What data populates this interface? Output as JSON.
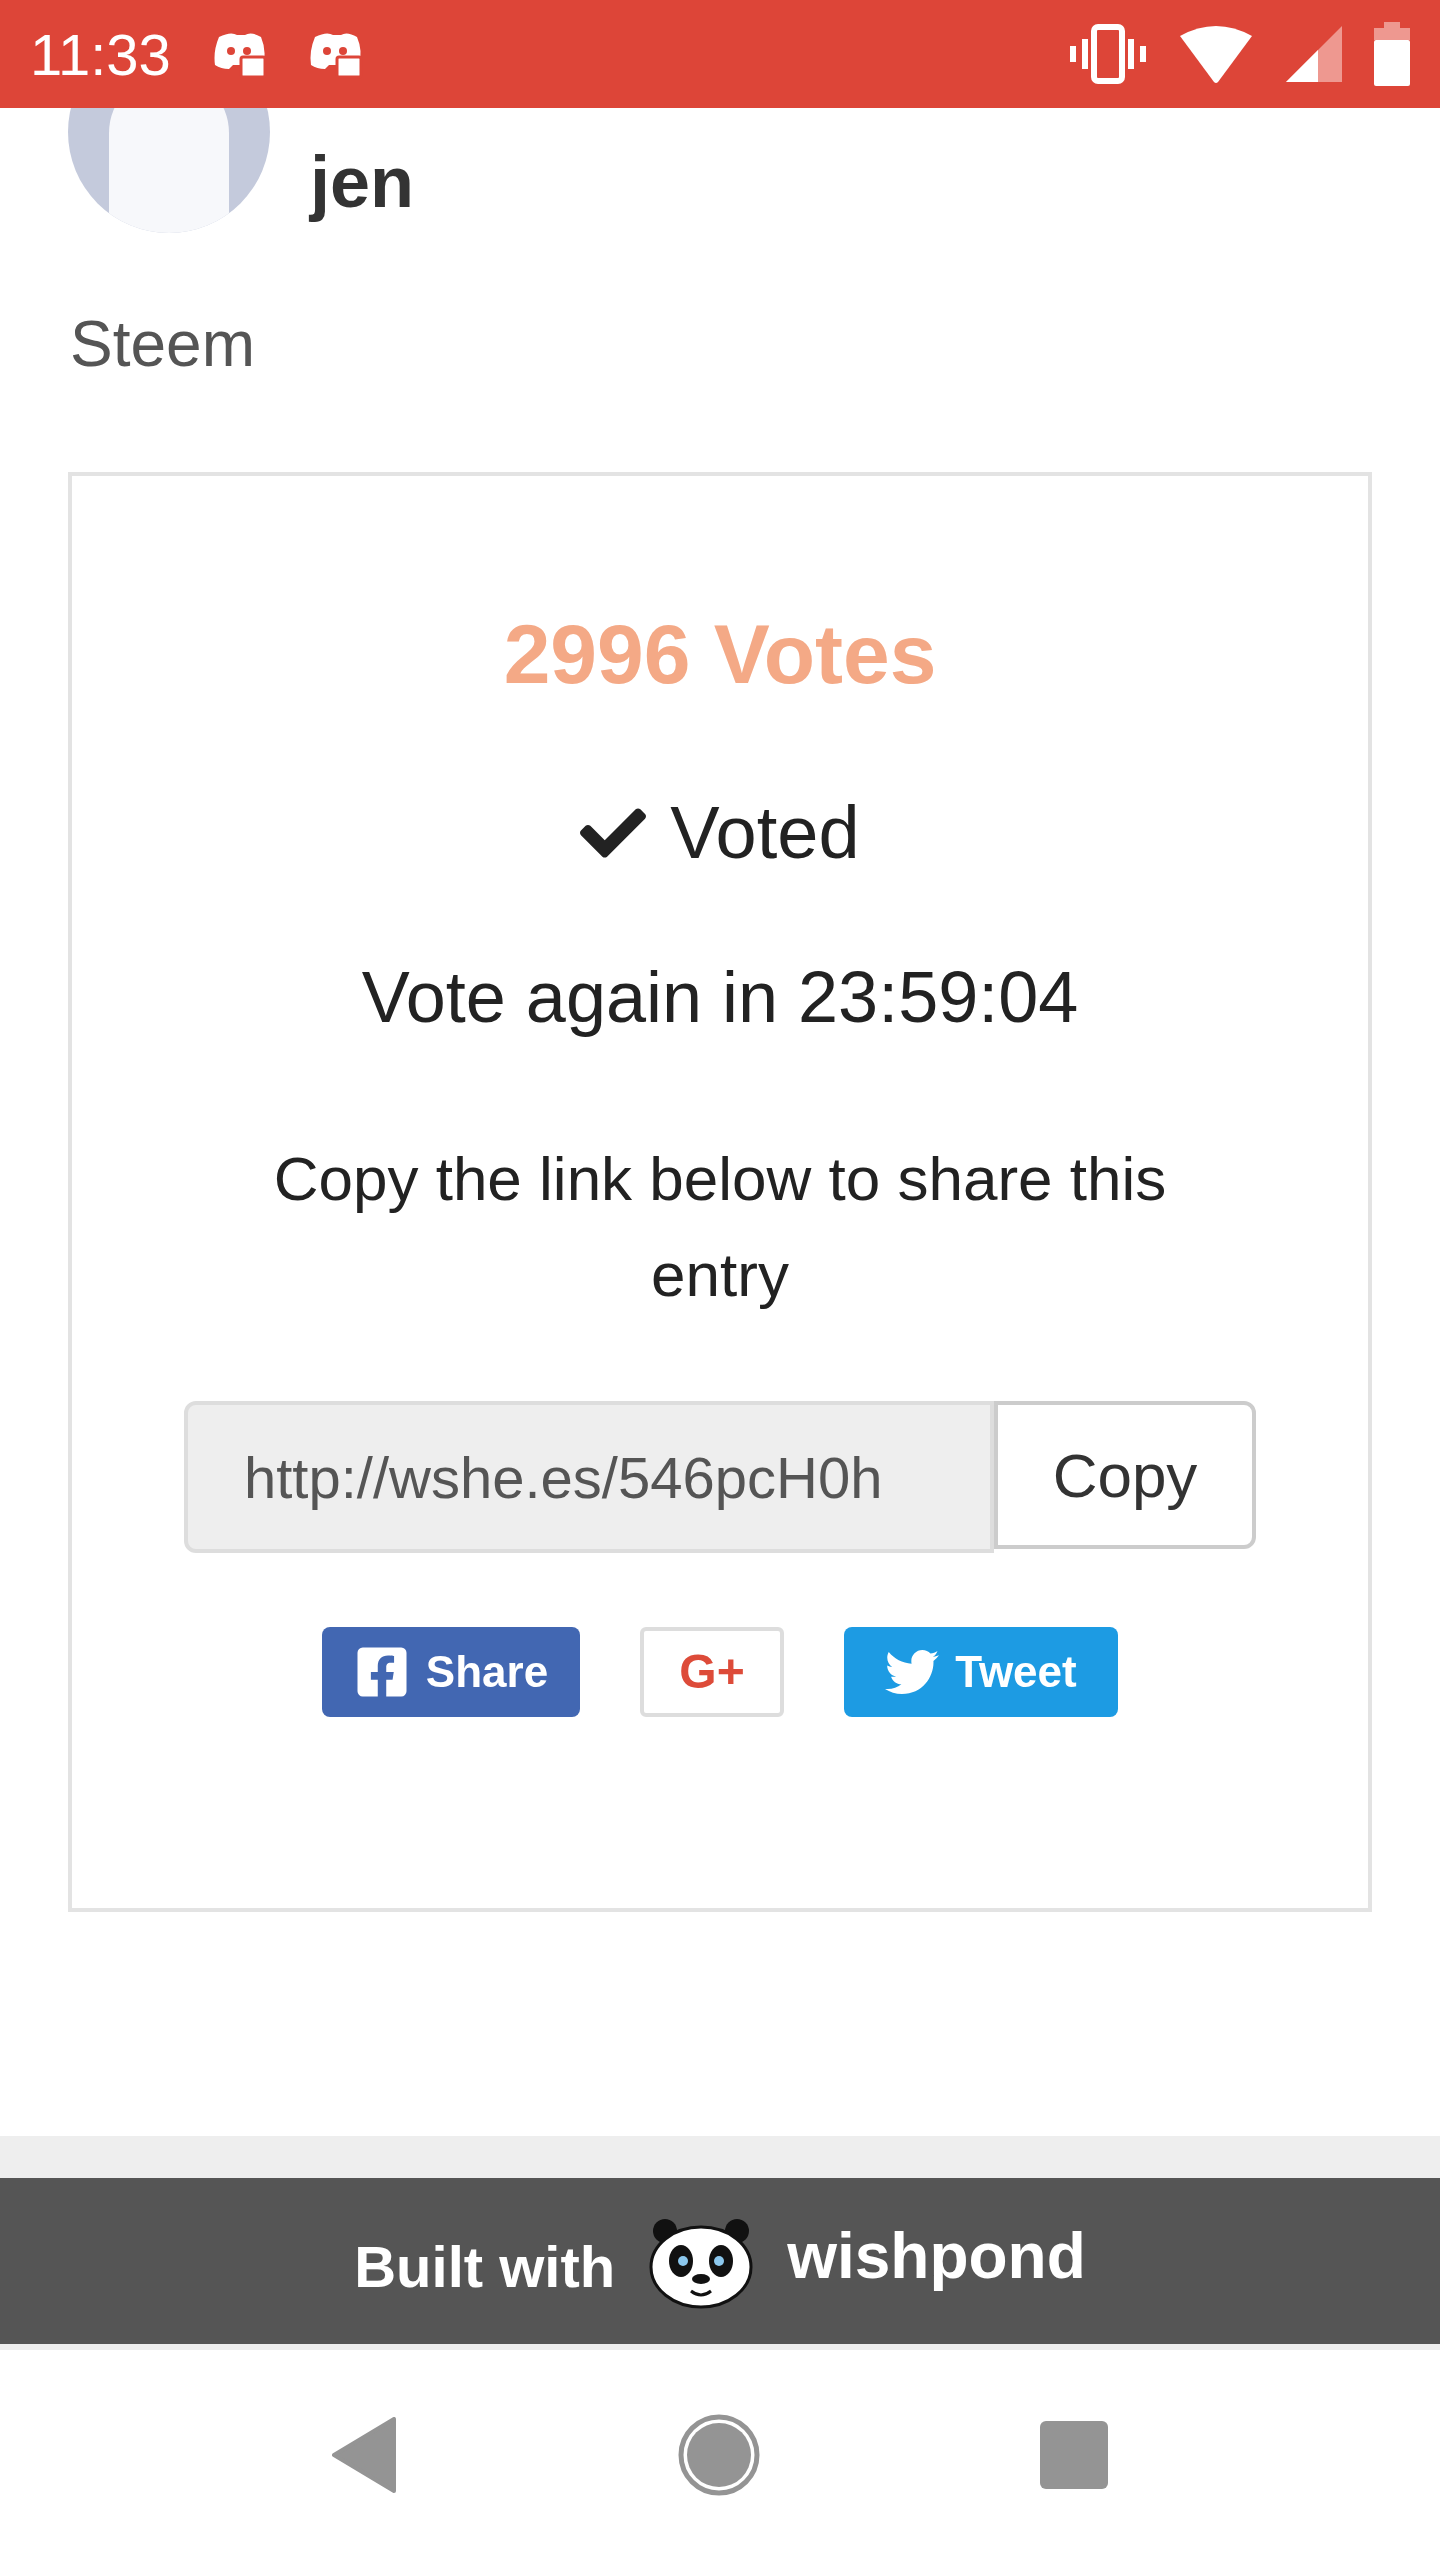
{
  "status_bar": {
    "time": "11:33"
  },
  "profile": {
    "name": "jen",
    "subtitle": "Steem"
  },
  "card": {
    "votes": "2996 Votes",
    "voted": true,
    "voted_label": "Voted",
    "countdown": "Vote again in 23:59:04",
    "share_hint": "Copy the link below to share this entry",
    "link": {
      "value": "http://wshe.es/546pcH0h"
    },
    "copy_button": "Copy",
    "share_buttons": [
      {
        "kind": "facebook",
        "label": "Share"
      },
      {
        "kind": "google",
        "label": "G+"
      },
      {
        "kind": "twitter",
        "label": "Tweet"
      }
    ]
  },
  "footer": {
    "built_with": "Built with",
    "brand": "wishpond"
  }
}
